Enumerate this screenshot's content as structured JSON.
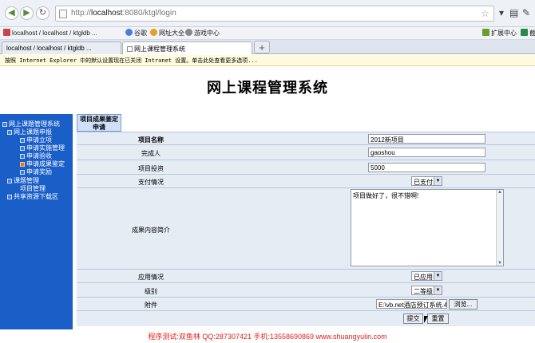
{
  "browser": {
    "url_prefix": "http://",
    "url_host": "localhost",
    "url_rest": ":8080/ktgl/login",
    "bookmarks": [
      {
        "label": "localhost / localhost / ktgldb ..."
      },
      {
        "label": "谷歌"
      },
      {
        "label": "网址大全"
      },
      {
        "label": "游戏中心"
      }
    ],
    "extensions_label": "扩展中心",
    "ext_extra": "截",
    "tabs": [
      {
        "label": "localhost / localhost / ktgldb ..."
      },
      {
        "label": "网上课程管理系统"
      }
    ],
    "infobar_text": "按照 Internet Explorer 中的默认设置现在已关闭 Intranet 设置。单击此处查看更多选项..."
  },
  "page": {
    "title": "网上课程管理系统"
  },
  "sidebar": {
    "items": [
      {
        "label": "网上课题管理系统"
      },
      {
        "label": "网上课题申报"
      },
      {
        "label": "申请立项"
      },
      {
        "label": "申请实施管理"
      },
      {
        "label": "申请验收"
      },
      {
        "label": "申请成果鉴定"
      },
      {
        "label": "申请奖励"
      },
      {
        "label": "课题管理"
      },
      {
        "label": "项目管理"
      },
      {
        "label": "共享资源下载区"
      }
    ]
  },
  "form": {
    "section_title": "项目成果鉴定申请",
    "fields": {
      "project_name": {
        "label": "项目名称",
        "value": "2012新项目"
      },
      "completer": {
        "label": "完成人",
        "value": "gaoshou"
      },
      "investment": {
        "label": "项目投资",
        "value": "5000"
      },
      "payment": {
        "label": "支付情况",
        "value": "已支付"
      },
      "summary": {
        "label": "成果内容简介",
        "value": "项目做好了，很不错啊!"
      },
      "application": {
        "label": "应用情况",
        "value": "已应用"
      },
      "level": {
        "label": "级别",
        "value": "二等级"
      },
      "attachment": {
        "label": "附件",
        "value": "E:\\vb.net酒店预订系统.4",
        "browse_label": "浏览..."
      }
    },
    "submit_label": "提交",
    "reset_label": "重置"
  },
  "footer": {
    "text": "程序测试:双鱼林 QQ:287307421 手机:13558690869 www.shuangyulin.com"
  },
  "colors": {
    "sidebar_bg": "#1a5ec8",
    "form_bg": "#e6ecf4",
    "footer_text": "#e0201a"
  }
}
